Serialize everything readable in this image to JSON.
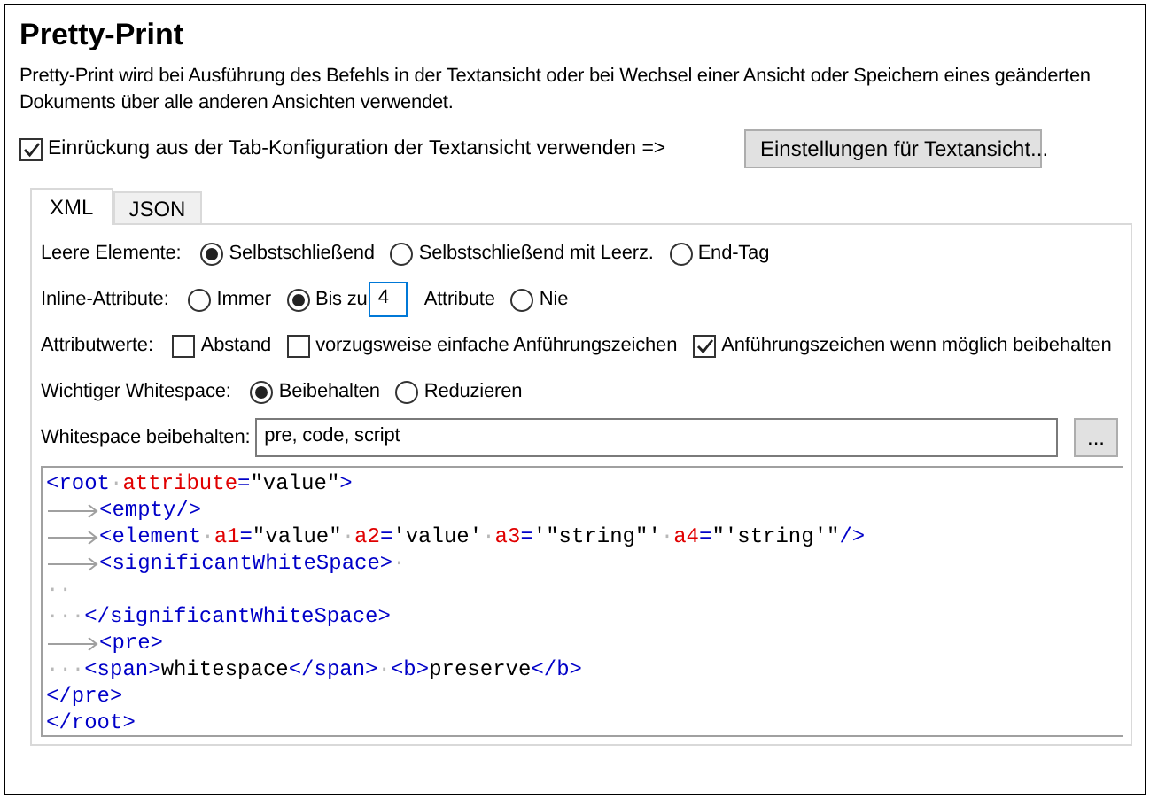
{
  "title": "Pretty-Print",
  "description": "Pretty-Print wird bei Ausführung des Befehls in der Textansicht oder bei Wechsel einer Ansicht oder Speichern eines geänderten Dokuments über alle anderen Ansichten verwendet.",
  "use_tab_config": {
    "label": "Einrückung aus der Tab-Konfiguration der Textansicht verwenden =>",
    "checked": true
  },
  "text_view_button": "Einstellungen für Textansicht...",
  "tabs": [
    {
      "label": "XML",
      "selected": true
    },
    {
      "label": "JSON",
      "selected": false
    }
  ],
  "option_rows": [
    {
      "label": "Leere Elemente:",
      "controls": [
        {
          "kind": "radio",
          "label": "Selbstschließend",
          "selected": true
        },
        {
          "kind": "radio",
          "label": "Selbstschließend mit Leerz.",
          "selected": false
        },
        {
          "kind": "radio",
          "label": "End-Tag",
          "selected": false
        }
      ]
    },
    {
      "label": "Inline-Attribute:",
      "controls": [
        {
          "kind": "radio",
          "label": "Immer",
          "selected": false
        },
        {
          "kind": "radio",
          "label": "Bis zu",
          "selected": true
        },
        {
          "kind": "number",
          "value": "4"
        },
        {
          "kind": "text",
          "text": "Attribute"
        },
        {
          "kind": "radio",
          "label": "Nie",
          "selected": false
        }
      ]
    },
    {
      "label": "Attributwerte:",
      "controls": [
        {
          "kind": "checkbox",
          "label": "Abstand",
          "checked": false
        },
        {
          "kind": "checkbox",
          "label": "vorzugsweise einfache Anführungszeichen",
          "checked": false
        },
        {
          "kind": "checkbox",
          "label": "Anführungszeichen wenn möglich beibehalten",
          "checked": true
        }
      ]
    },
    {
      "label": "Wichtiger Whitespace:",
      "controls": [
        {
          "kind": "radio",
          "label": "Beibehalten",
          "selected": true
        },
        {
          "kind": "radio",
          "label": "Reduzieren",
          "selected": false
        }
      ]
    },
    {
      "label": "Whitespace beibehalten:",
      "controls": [
        {
          "kind": "field",
          "value": "pre, code, script"
        },
        {
          "kind": "button",
          "label": "..."
        }
      ]
    }
  ],
  "code_preview": {
    "lines": [
      {
        "tokens": [
          {
            "kind": "tag",
            "text": "<root"
          },
          {
            "kind": "space",
            "text": "·"
          },
          {
            "kind": "attr",
            "text": "attribute"
          },
          {
            "kind": "tag",
            "text": "="
          },
          {
            "kind": "value",
            "text": "\"value\""
          },
          {
            "kind": "tag",
            "text": ">"
          }
        ]
      },
      {
        "tokens": [
          {
            "kind": "tab"
          },
          {
            "kind": "tag",
            "text": "<empty/>"
          }
        ]
      },
      {
        "tokens": [
          {
            "kind": "tab"
          },
          {
            "kind": "tag",
            "text": "<element"
          },
          {
            "kind": "space",
            "text": "·"
          },
          {
            "kind": "attr",
            "text": "a1"
          },
          {
            "kind": "tag",
            "text": "="
          },
          {
            "kind": "value",
            "text": "\"value\""
          },
          {
            "kind": "space",
            "text": "·"
          },
          {
            "kind": "attr",
            "text": "a2"
          },
          {
            "kind": "tag",
            "text": "="
          },
          {
            "kind": "value",
            "text": "'value'"
          },
          {
            "kind": "space",
            "text": "·"
          },
          {
            "kind": "attr",
            "text": "a3"
          },
          {
            "kind": "tag",
            "text": "="
          },
          {
            "kind": "value",
            "text": "'\"string\"'"
          },
          {
            "kind": "space",
            "text": "·"
          },
          {
            "kind": "attr",
            "text": "a4"
          },
          {
            "kind": "tag",
            "text": "="
          },
          {
            "kind": "value",
            "text": "\"'string'\""
          },
          {
            "kind": "tag",
            "text": "/>"
          }
        ]
      },
      {
        "tokens": [
          {
            "kind": "tab"
          },
          {
            "kind": "tag",
            "text": "<significantWhiteSpace>"
          },
          {
            "kind": "space",
            "text": "·"
          }
        ]
      },
      {
        "tokens": [
          {
            "kind": "space",
            "text": "··"
          }
        ]
      },
      {
        "tokens": [
          {
            "kind": "space",
            "text": "···"
          },
          {
            "kind": "tag",
            "text": "</significantWhiteSpace>"
          }
        ]
      },
      {
        "tokens": [
          {
            "kind": "tab"
          },
          {
            "kind": "tag",
            "text": "<pre>"
          }
        ]
      },
      {
        "tokens": [
          {
            "kind": "space",
            "text": "···"
          },
          {
            "kind": "tag",
            "text": "<span>"
          },
          {
            "kind": "value",
            "text": "whitespace"
          },
          {
            "kind": "tag",
            "text": "</span>"
          },
          {
            "kind": "space",
            "text": "·"
          },
          {
            "kind": "tag",
            "text": "<b>"
          },
          {
            "kind": "value",
            "text": "preserve"
          },
          {
            "kind": "tag",
            "text": "</b>"
          }
        ]
      },
      {
        "tokens": [
          {
            "kind": "tag",
            "text": "</pre>"
          }
        ]
      },
      {
        "tokens": [
          {
            "kind": "tag",
            "text": "</root>"
          }
        ]
      }
    ]
  }
}
